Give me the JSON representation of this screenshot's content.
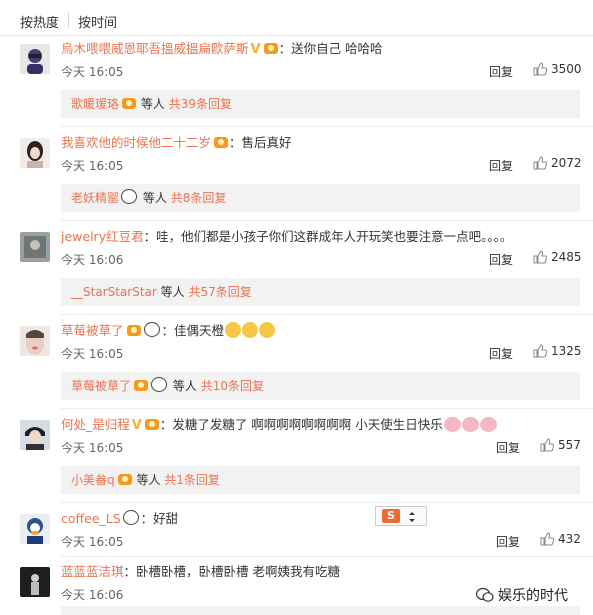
{
  "sort_tabs": {
    "by_hot": "按热度",
    "by_time": "按时间"
  },
  "reply_label": "回复",
  "comments": [
    {
      "user": "烏木喂喂威恩耶吾搵威搵扁歐萨斯",
      "text": "：送你自己 哈哈哈",
      "time": "今天 16:05",
      "likes": "3500",
      "sub": {
        "name": "歌暖瑷珞",
        "etc": "等人",
        "count": "共39条回复"
      }
    },
    {
      "user": "我喜欢他的时候他二十二岁",
      "text": "：售后真好",
      "time": "今天 16:05",
      "likes": "2072",
      "sub": {
        "name": "老妖精罂",
        "etc": "等人",
        "count": "共8条回复"
      }
    },
    {
      "user": "jewelry红豆君",
      "text": "：哇，他们都是小孩子你们这群成年人开玩笑也要注意一点吧。。。。",
      "time": "今天 16:06",
      "likes": "2485",
      "sub": {
        "name": "__StarStarStar",
        "etc": "等人",
        "count": "共57条回复"
      }
    },
    {
      "user": "草莓被草了",
      "text": "：佳偶天橙",
      "time": "今天 16:05",
      "likes": "1325",
      "sub": {
        "name": "草莓被草了",
        "etc": "等人",
        "count": "共10条回复"
      }
    },
    {
      "user": "何处_是归程",
      "text": "：发糖了发糖了 啊啊啊啊啊啊啊啊 小天使生日快乐",
      "time": "今天 16:05",
      "likes": "557",
      "sub": {
        "name": "小美畚q",
        "etc": "等人",
        "count": "共1条回复"
      }
    },
    {
      "user": "coffee_LS",
      "text": "：好甜",
      "time": "今天 16:05",
      "likes": "432"
    },
    {
      "user": "蓝蓝蓝洁琪",
      "text": "：卧槽卧槽，卧槽卧槽 老啊姨我有吃糖",
      "time": "今天 16:06"
    }
  ],
  "popup_letter": "S",
  "watermark": "娱乐的时代",
  "colors": {
    "username": "#eb7350",
    "sub_bg": "#f2f2f2",
    "badge": "#f5b23a"
  }
}
